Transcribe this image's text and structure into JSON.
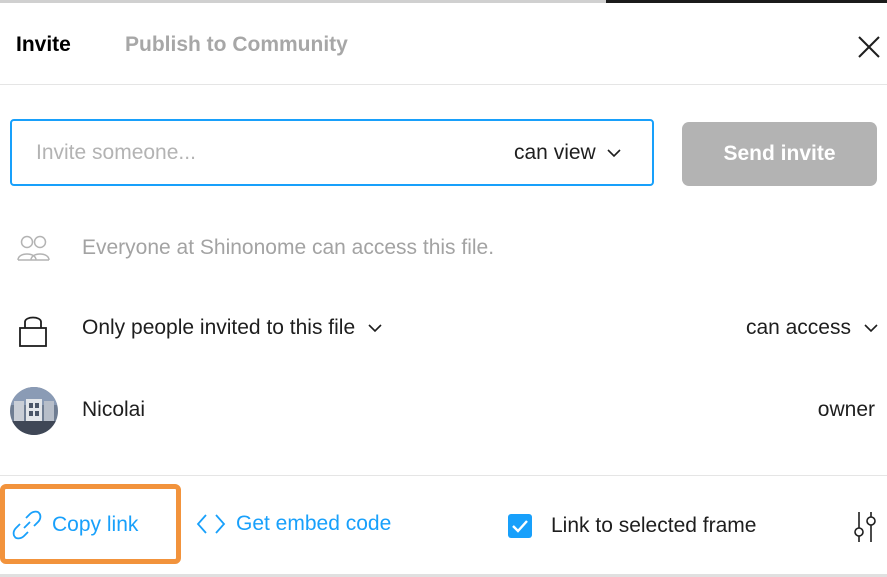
{
  "header": {
    "tabs": [
      {
        "label": "Invite",
        "active": true
      },
      {
        "label": "Publish to Community",
        "active": false
      }
    ],
    "close_icon": "close-icon"
  },
  "invite": {
    "input_value": "",
    "input_placeholder": "Invite someone...",
    "permission_value": "can view",
    "send_label": "Send invite",
    "send_enabled": false
  },
  "team": {
    "icon": "team-icon",
    "text": "Everyone at Shinonome can access this file."
  },
  "link_settings": {
    "icon": "lock-icon",
    "scope_label": "Only people invited to this file",
    "access_label": "can access"
  },
  "members": [
    {
      "name": "Nicolai",
      "role": "owner",
      "avatar": "avatar-image"
    }
  ],
  "footer": {
    "copy_link_label": "Copy link",
    "copy_link_icon": "link-icon",
    "embed_label": "Get embed code",
    "embed_icon": "code-icon",
    "link_to_frame_label": "Link to selected frame",
    "link_to_frame_checked": true,
    "settings_icon": "sliders-icon"
  },
  "colors": {
    "accent": "#18a0fb",
    "highlight": "#f2933c",
    "disabled_button": "#b3b3b3",
    "muted_text": "#a3a3a3"
  }
}
